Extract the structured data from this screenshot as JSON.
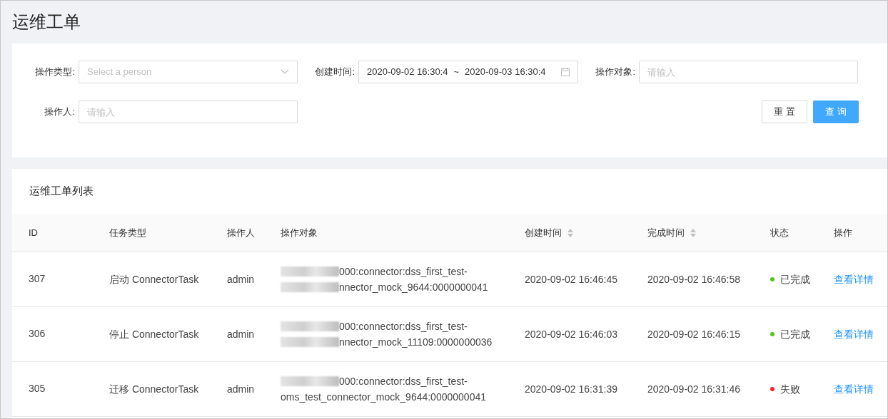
{
  "page_title": "运维工单",
  "filters": {
    "operation_type": {
      "label": "操作类型:",
      "placeholder": "Select a person"
    },
    "created_time": {
      "label": "创建时间:",
      "start": "2020-09-02 16:30:4",
      "separator": "~",
      "end": "2020-09-03 16:30:4"
    },
    "target": {
      "label": "操作对象:",
      "placeholder": "请输入"
    },
    "operator": {
      "label": "操作人:",
      "placeholder": "请输入"
    },
    "buttons": [
      {
        "label": "重 置",
        "kind": "default"
      },
      {
        "label": "查 询",
        "kind": "primary"
      }
    ]
  },
  "table": {
    "title": "运维工单列表",
    "columns": [
      {
        "label": "ID",
        "sortable": false
      },
      {
        "label": "任务类型",
        "sortable": false
      },
      {
        "label": "操作人",
        "sortable": false
      },
      {
        "label": "操作对象",
        "sortable": false
      },
      {
        "label": "创建时间",
        "sortable": true
      },
      {
        "label": "完成时间",
        "sortable": true
      },
      {
        "label": "状态",
        "sortable": false
      },
      {
        "label": "操作",
        "sortable": false
      }
    ],
    "rows": [
      {
        "id": "307",
        "task_type": "启动 ConnectorTask",
        "operator": "admin",
        "target": [
          {
            "text": "000:connector:dss_first_test-",
            "blurred": true
          },
          {
            "text": "nnector_mock_9644:0000000041",
            "blurred": true
          }
        ],
        "created": "2020-09-02 16:46:45",
        "finished": "2020-09-02 16:46:58",
        "status": {
          "text": "已完成",
          "color": "#52c41a"
        },
        "action": "查看详情"
      },
      {
        "id": "306",
        "task_type": "停止 ConnectorTask",
        "operator": "admin",
        "target": [
          {
            "text": "000:connector:dss_first_test-",
            "blurred": true
          },
          {
            "text": "nnector_mock_11109:0000000036",
            "blurred": true
          }
        ],
        "created": "2020-09-02 16:46:03",
        "finished": "2020-09-02 16:46:15",
        "status": {
          "text": "已完成",
          "color": "#52c41a"
        },
        "action": "查看详情"
      },
      {
        "id": "305",
        "task_type": "迁移 ConnectorTask",
        "operator": "admin",
        "target": [
          {
            "text": "000:connector:dss_first_test-",
            "blurred": true
          },
          {
            "text": "oms_test_connector_mock_9644:0000000041",
            "blurred": false
          }
        ],
        "created": "2020-09-02 16:31:39",
        "finished": "2020-09-02 16:31:46",
        "status": {
          "text": "失败",
          "color": "#f5222d"
        },
        "action": "查看详情"
      }
    ]
  }
}
